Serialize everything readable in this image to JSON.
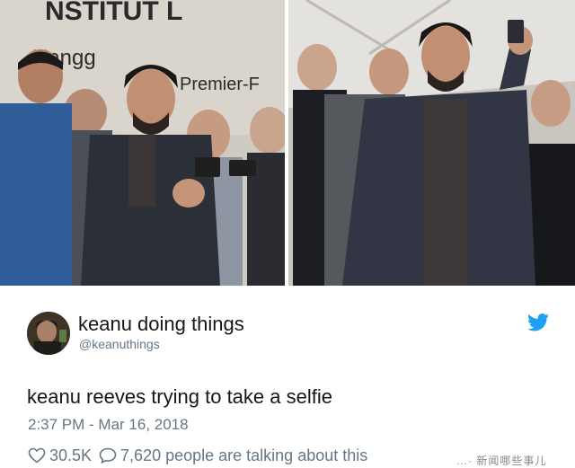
{
  "left_photo": {
    "sign_line1": "NSTITUT L",
    "sign_line2": "Hangg",
    "sign_line3": "Premier-F"
  },
  "tweet": {
    "display_name": "keanu doing things",
    "handle": "@keanuthings",
    "text": "keanu reeves trying to take a selfie",
    "timestamp": "2:37 PM - Mar 16, 2018",
    "likes": "30.5K",
    "talking": "7,620 people are talking about this"
  },
  "icons": {
    "brand": "twitter-bird-icon",
    "like": "heart-icon",
    "reply": "speech-bubble-icon"
  },
  "colors": {
    "twitter_blue": "#1da1f2",
    "text_primary": "#14171a",
    "text_secondary": "#657786"
  },
  "watermark": {
    "text": "…· 新闻哪些事儿"
  }
}
